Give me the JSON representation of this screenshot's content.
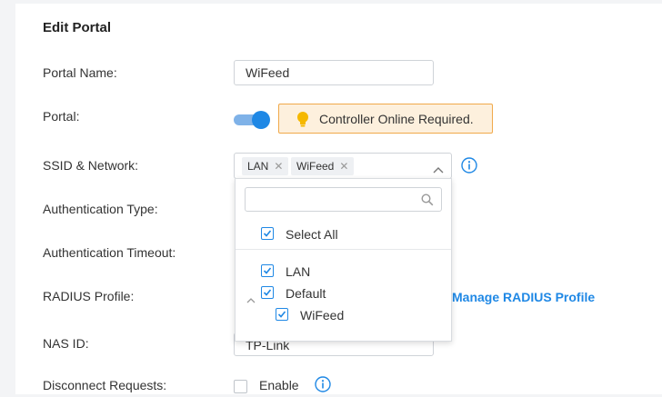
{
  "page": {
    "title": "Edit Portal"
  },
  "form": {
    "portal_name_label": "Portal Name",
    "portal_name_value": "WiFeed",
    "portal_label": "Portal",
    "portal_enabled": true,
    "portal_warning": "Controller Online Required.",
    "ssid_label": "SSID & Network",
    "ssid_tags": [
      "LAN",
      "WiFeed"
    ],
    "auth_type_label": "Authentication Type",
    "auth_timeout_label": "Authentication Timeout",
    "radius_label": "RADIUS Profile",
    "manage_radius_link": "Manage RADIUS Profile",
    "nas_id_label": "NAS ID",
    "nas_id_value": "TP-Link",
    "disconnect_label": "Disconnect Requests",
    "enable_label": "Enable",
    "colon": ":"
  },
  "dropdown": {
    "search_placeholder": "",
    "select_all": "Select All",
    "options": [
      {
        "label": "LAN",
        "checked": true
      },
      {
        "label": "Default",
        "checked": true,
        "expanded": true
      },
      {
        "label": "WiFeed",
        "checked": true,
        "child": true
      }
    ]
  },
  "colors": {
    "accent": "#1f88e5",
    "warning_bg": "#fdf0dd",
    "warning_border": "#f0a94a",
    "bulb": "#f5b800"
  },
  "icons": [
    "bulb-icon",
    "chevron-up-icon",
    "info-icon",
    "search-icon",
    "check-icon",
    "caret-up-icon",
    "close-icon"
  ]
}
